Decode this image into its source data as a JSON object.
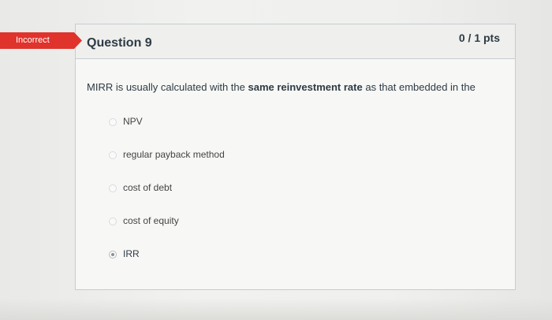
{
  "badge": {
    "label": "Incorrect",
    "color": "#e0332c"
  },
  "question": {
    "title": "Question 9",
    "points": "0 / 1 pts",
    "text_part1": "MIRR is usually calculated with the ",
    "text_bold": "same reinvestment rate",
    "text_part2": " as that embedded in the"
  },
  "answers": [
    {
      "label": "NPV",
      "selected": false
    },
    {
      "label": "regular payback method",
      "selected": false
    },
    {
      "label": "cost of debt",
      "selected": false
    },
    {
      "label": "cost of equity",
      "selected": false
    },
    {
      "label": "IRR",
      "selected": true
    }
  ]
}
